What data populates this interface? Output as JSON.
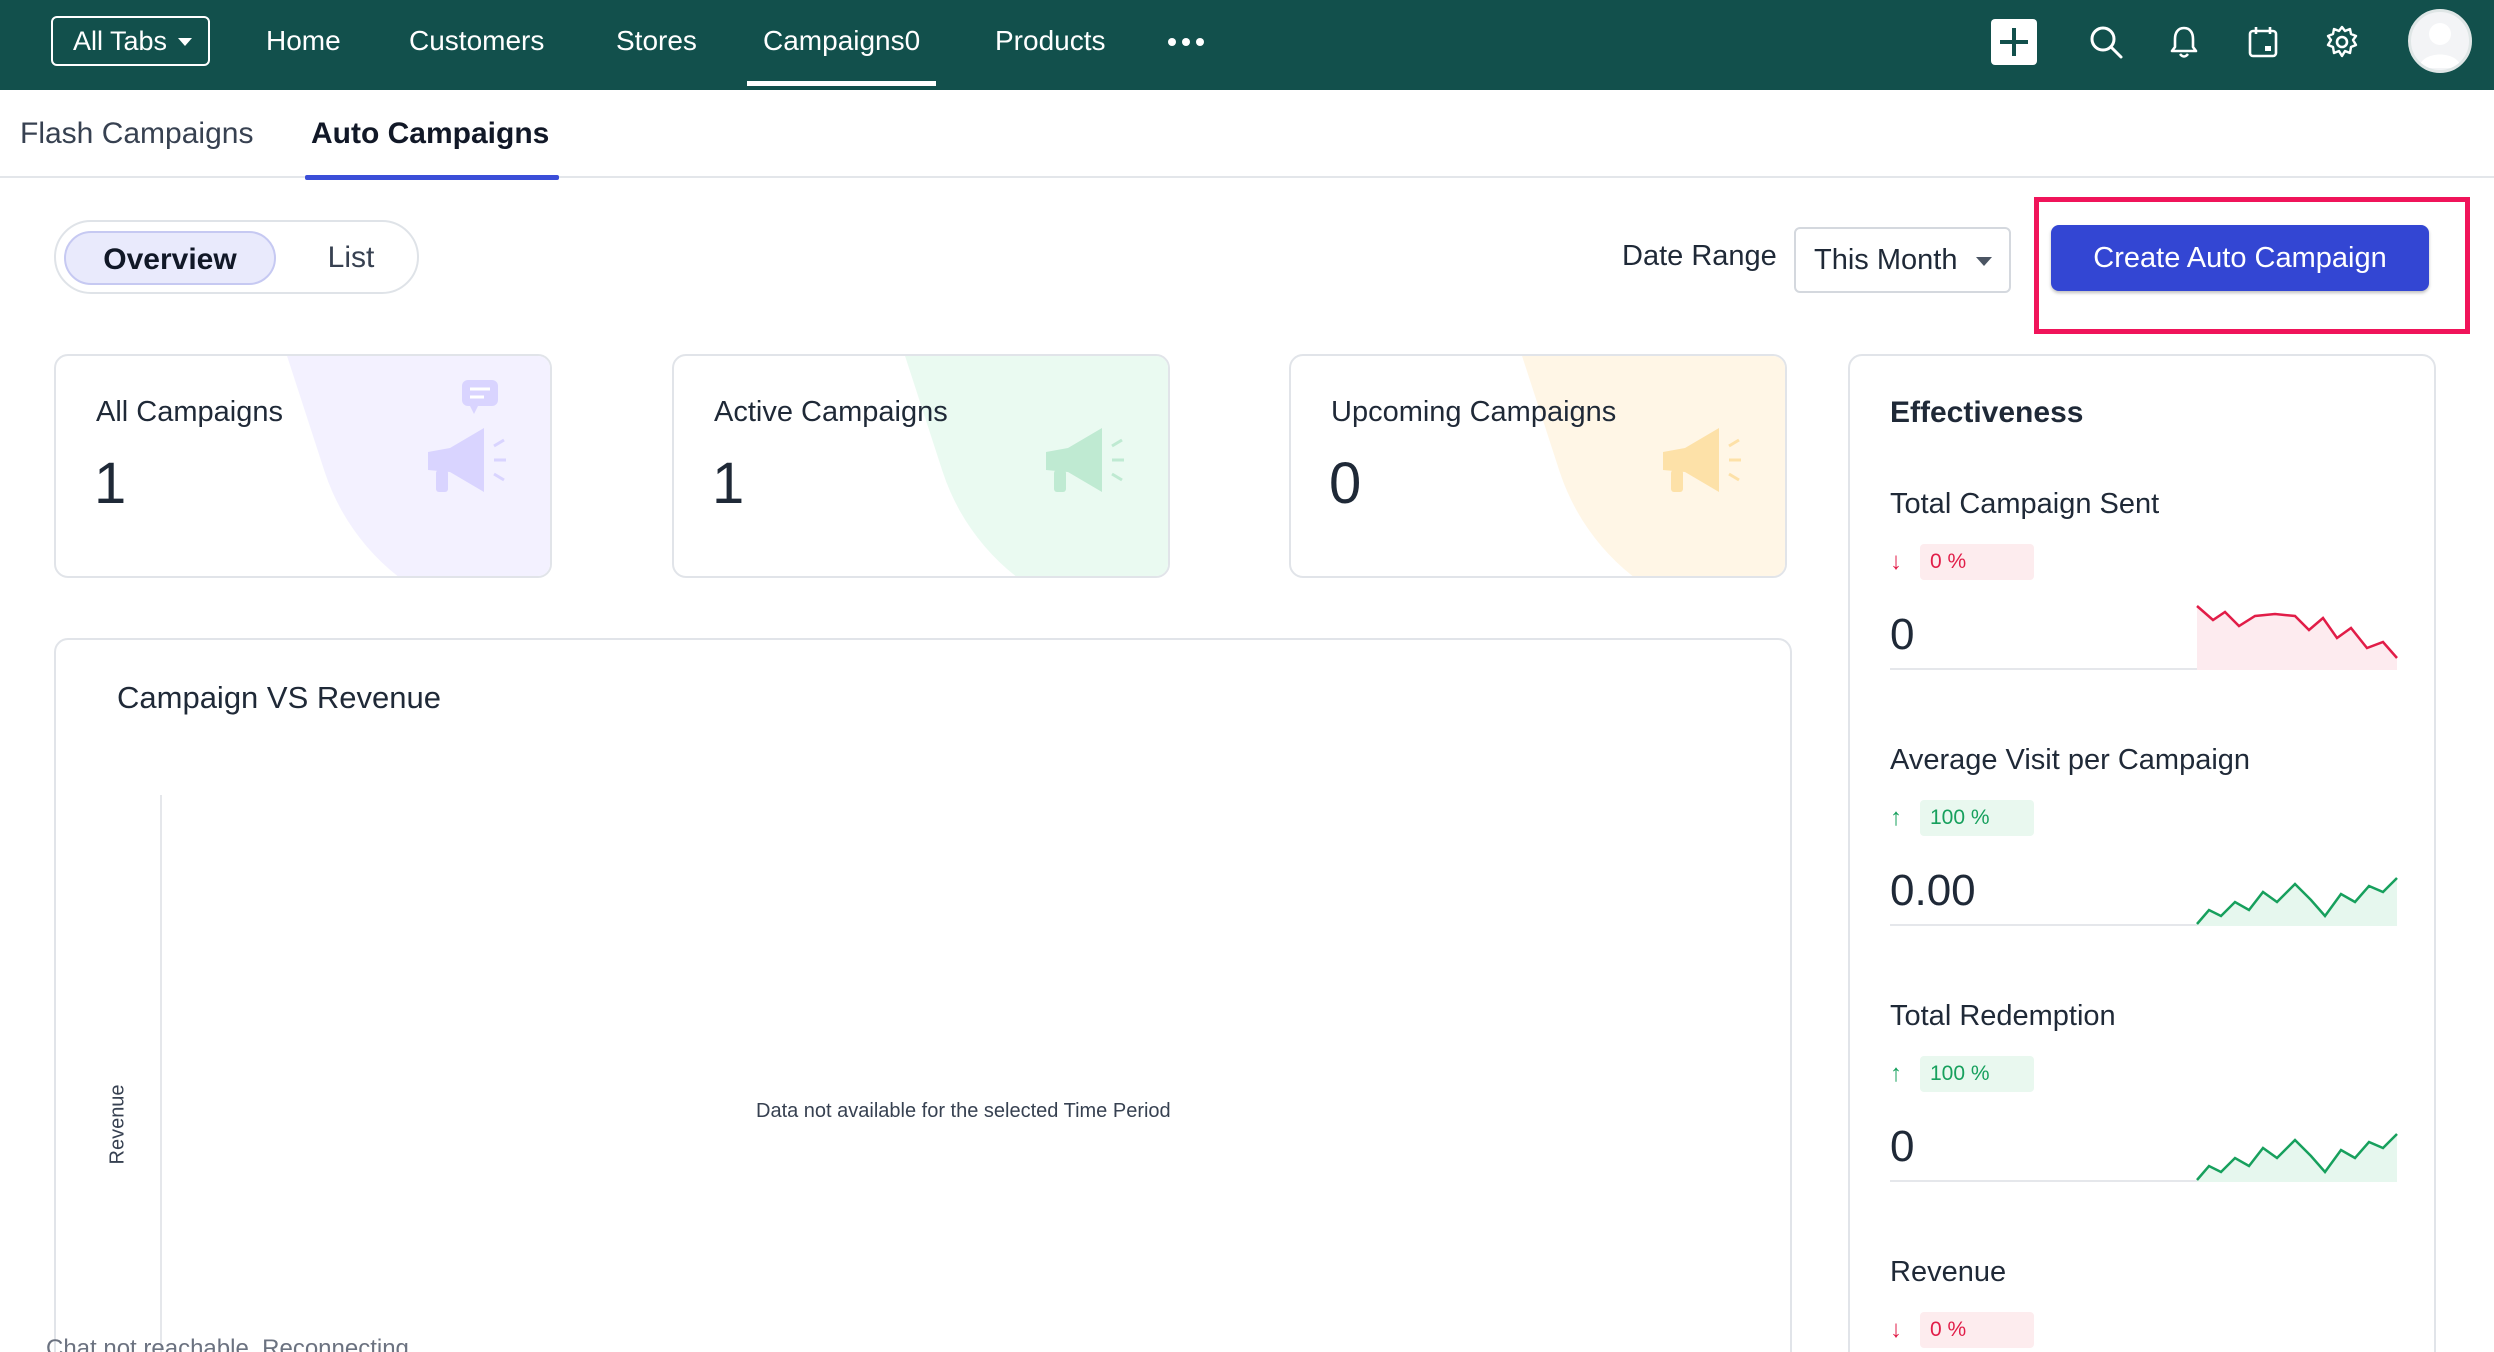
{
  "topnav": {
    "all_tabs_label": "All Tabs",
    "items": [
      "Home",
      "Customers",
      "Stores",
      "Campaigns0",
      "Products"
    ],
    "active_item": "Campaigns0",
    "icons": [
      "plus-icon",
      "search-icon",
      "bell-icon",
      "calendar-icon",
      "gear-icon",
      "more-icon"
    ],
    "bg_color": "#12504c"
  },
  "subtabs": {
    "items": [
      "Flash Campaigns",
      "Auto Campaigns"
    ],
    "active": "Auto Campaigns",
    "accent": "#3b4ed8"
  },
  "view_toggle": {
    "overview_label": "Overview",
    "list_label": "List",
    "selected": "Overview"
  },
  "date_range": {
    "label": "Date Range",
    "selected": "This Month"
  },
  "create_button": {
    "label": "Create Auto Campaign",
    "color": "#3346d3",
    "highlight_color": "#f0145a"
  },
  "stat_cards": [
    {
      "title": "All Campaigns",
      "value": "1",
      "accent": "#f1efff",
      "icon_color": "#d9d4ff"
    },
    {
      "title": "Active Campaigns",
      "value": "1",
      "accent": "#eafaf1",
      "icon_color": "#bfead2"
    },
    {
      "title": "Upcoming Campaigns",
      "value": "0",
      "accent": "#fff6e6",
      "icon_color": "#fde1a8"
    }
  ],
  "chart": {
    "title": "Campaign VS Revenue",
    "ylabel": "Revenue",
    "empty_message": "Data not available for the selected Time Period"
  },
  "chart_status": "Chat not reachable. Reconnecting",
  "effectiveness": {
    "title": "Effectiveness",
    "metrics": [
      {
        "label": "Total Campaign Sent",
        "change": "0 %",
        "direction": "down",
        "value": "0"
      },
      {
        "label": "Average Visit per Campaign",
        "change": "100 %",
        "direction": "up",
        "value": "0.00"
      },
      {
        "label": "Total Redemption",
        "change": "100 %",
        "direction": "up",
        "value": "0"
      },
      {
        "label": "Revenue",
        "change": "0 %",
        "direction": "down",
        "value": ""
      }
    ],
    "down_color": "#e11d48",
    "up_color": "#17a05d"
  }
}
